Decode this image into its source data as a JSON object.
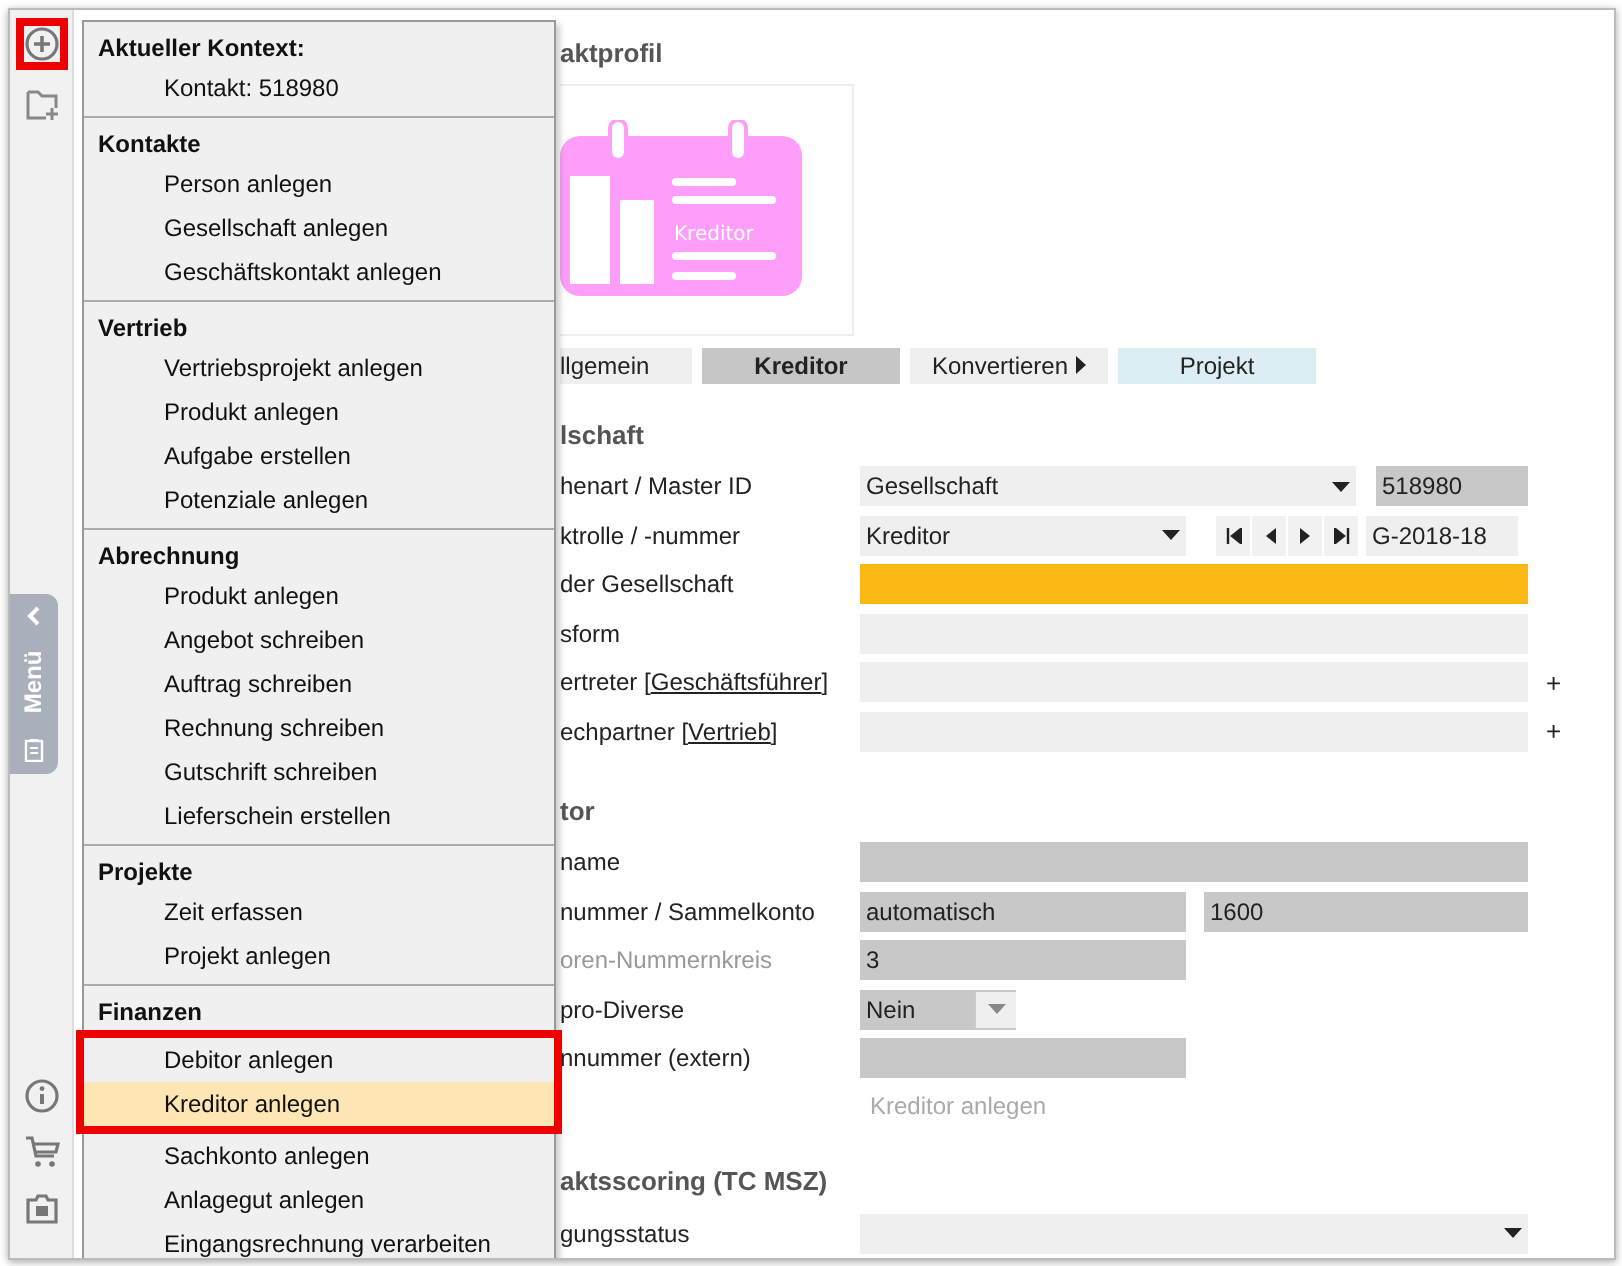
{
  "sidebar": {
    "new_button": {
      "marked": true
    },
    "menu_tab": {
      "label": "Menü"
    }
  },
  "menu": {
    "sections": [
      {
        "header": "Aktueller Kontext:",
        "items": [
          {
            "label": "Kontakt: 518980",
            "selected": false,
            "marked": false
          }
        ]
      },
      {
        "header": "Kontakte",
        "items": [
          {
            "label": "Person anlegen",
            "selected": false,
            "marked": false
          },
          {
            "label": "Gesellschaft anlegen",
            "selected": false,
            "marked": false
          },
          {
            "label": "Geschäftskontakt anlegen",
            "selected": false,
            "marked": false
          }
        ]
      },
      {
        "header": "Vertrieb",
        "items": [
          {
            "label": "Vertriebsprojekt anlegen",
            "selected": false,
            "marked": false
          },
          {
            "label": "Produkt anlegen",
            "selected": false,
            "marked": false
          },
          {
            "label": "Aufgabe erstellen",
            "selected": false,
            "marked": false
          },
          {
            "label": "Potenziale anlegen",
            "selected": false,
            "marked": false
          }
        ]
      },
      {
        "header": "Abrechnung",
        "items": [
          {
            "label": "Produkt anlegen",
            "selected": false,
            "marked": false
          },
          {
            "label": "Angebot schreiben",
            "selected": false,
            "marked": false
          },
          {
            "label": "Auftrag schreiben",
            "selected": false,
            "marked": false
          },
          {
            "label": "Rechnung schreiben",
            "selected": false,
            "marked": false
          },
          {
            "label": "Gutschrift schreiben",
            "selected": false,
            "marked": false
          },
          {
            "label": "Lieferschein erstellen",
            "selected": false,
            "marked": false
          }
        ]
      },
      {
        "header": "Projekte",
        "items": [
          {
            "label": "Zeit erfassen",
            "selected": false,
            "marked": false
          },
          {
            "label": "Projekt anlegen",
            "selected": false,
            "marked": false
          }
        ]
      },
      {
        "header": "Finanzen",
        "items": [
          {
            "label": "Debitor anlegen",
            "selected": false,
            "marked": true
          },
          {
            "label": "Kreditor anlegen",
            "selected": true,
            "marked": true
          },
          {
            "label": "Sachkonto anlegen",
            "selected": false,
            "marked": false
          },
          {
            "label": "Anlagegut anlegen",
            "selected": false,
            "marked": false
          },
          {
            "label": "Eingangsrechnung verarbeiten",
            "selected": false,
            "marked": false
          }
        ]
      }
    ]
  },
  "profile": {
    "title": "aktprofil",
    "card_text": "Kreditor",
    "tabs": [
      {
        "label": "llgemein",
        "selected": false,
        "kind": "plain"
      },
      {
        "label": "Kreditor",
        "selected": true,
        "kind": "plain"
      },
      {
        "label": "Konvertieren",
        "selected": false,
        "kind": "submenu"
      },
      {
        "label": "Projekt",
        "selected": false,
        "kind": "accent"
      }
    ],
    "sections": [
      {
        "title": "lschaft",
        "rows": [
          {
            "kind": "select_id",
            "label": "henart / Master ID",
            "disabled": false,
            "fields": [
              {
                "value": "Gesellschaft",
                "readonly": false,
                "required": false
              },
              {
                "value": "518980",
                "readonly": true,
                "required": false
              }
            ]
          },
          {
            "kind": "select_nav",
            "label": "ktrolle / -nummer",
            "disabled": false,
            "fields": [
              {
                "value": "Kreditor",
                "readonly": false,
                "required": false
              },
              {
                "value": "G-2018-18",
                "readonly": false,
                "required": false
              }
            ]
          },
          {
            "kind": "wide",
            "label": "der Gesellschaft",
            "disabled": false,
            "fields": [
              {
                "required": true
              }
            ]
          },
          {
            "kind": "wide",
            "label": "sform",
            "disabled": false,
            "fields": [
              {
                "readonly": false,
                "required": false
              }
            ]
          },
          {
            "kind": "wide",
            "label": "ertreter [",
            "link": "Geschäftsführer",
            "after": "]",
            "plus": "+",
            "disabled": false,
            "fields": [
              {
                "readonly": false,
                "required": false
              }
            ]
          },
          {
            "kind": "wide",
            "label": "echpartner [",
            "link": "Vertrieb",
            "after": "]",
            "plus": "+",
            "disabled": false,
            "fields": [
              {
                "readonly": false,
                "required": false
              }
            ]
          }
        ]
      },
      {
        "title": "tor",
        "rows": [
          {
            "kind": "wide",
            "label": "name",
            "disabled": false,
            "fields": [
              {
                "readonly": true,
                "required": false
              }
            ]
          },
          {
            "kind": "pair",
            "label": "nummer / Sammelkonto",
            "disabled": false,
            "fields": [
              {
                "value": "automatisch",
                "readonly": true,
                "required": false
              },
              {
                "value": "1600",
                "readonly": true,
                "required": false
              }
            ]
          },
          {
            "kind": "short",
            "label": "oren-Nummernkreis",
            "disabled": true,
            "fields": [
              {
                "value": "3",
                "readonly": true,
                "required": false
              }
            ]
          },
          {
            "kind": "combo",
            "label": "pro-Diverse",
            "disabled": false,
            "fields": [
              {
                "value": "Nein",
                "readonly": true,
                "required": false
              }
            ]
          },
          {
            "kind": "short",
            "label": "nnummer (extern)",
            "disabled": false,
            "fields": [
              {
                "readonly": true,
                "required": false
              }
            ]
          }
        ],
        "action": "Kreditor anlegen"
      },
      {
        "title": "aktsscoring (TC MSZ)",
        "rows": [
          {
            "kind": "wide_select",
            "label": "gungsstatus",
            "disabled": false,
            "fields": [
              {
                "readonly": false,
                "required": false
              }
            ]
          }
        ]
      }
    ]
  }
}
